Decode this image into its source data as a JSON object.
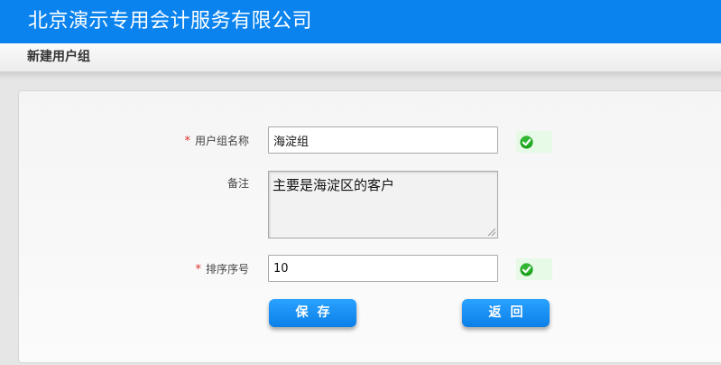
{
  "header": {
    "app_title": "北京演示专用会计服务有限公司"
  },
  "subheader": {
    "page_title": "新建用户组"
  },
  "form": {
    "required_mark": "*",
    "group_name": {
      "label": "用户组名称",
      "value": "海淀组",
      "valid": true
    },
    "remark": {
      "label": "备注",
      "value": "主要是海淀区的客户"
    },
    "sort_order": {
      "label": "排序序号",
      "value": "10",
      "valid": true
    }
  },
  "actions": {
    "save_label": "保存",
    "back_label": "返回"
  },
  "colors": {
    "header_bg": "#0a83ef",
    "button_bg": "#0b7fe8",
    "required": "#e0332c",
    "valid": "#1aa31a"
  }
}
